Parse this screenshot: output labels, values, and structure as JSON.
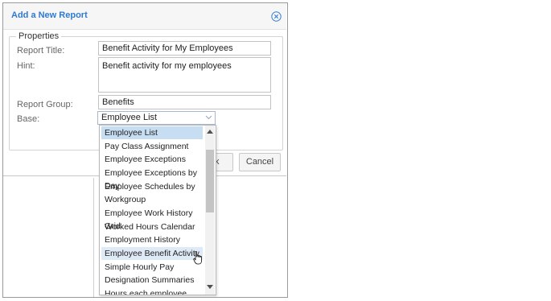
{
  "dialog": {
    "title": "Add a New Report",
    "close_icon": "close-circle-icon",
    "properties_legend": "Properties",
    "report_title": {
      "label": "Report Title:",
      "value": "Benefit Activity for My Employees"
    },
    "hint": {
      "label": "Hint:",
      "value": "Benefit activity for my employees"
    },
    "report_group": {
      "label": "Report Group:",
      "value": "Benefits"
    },
    "base": {
      "label": "Base:",
      "value": "Employee List"
    },
    "buttons": {
      "back_partial": "k",
      "cancel": "Cancel"
    }
  },
  "dropdown": {
    "items": [
      "Employee List",
      "Pay Class Assignment",
      "Employee Exceptions",
      "Employee Exceptions by Day",
      "Employee Schedules by",
      "Workgroup",
      "Employee Work History Grid",
      "Worked Hours Calendar",
      "Employment History Detail",
      "Employee Benefit Activity",
      "Simple Hourly Pay",
      "Designation Summaries",
      "Hours each employee"
    ],
    "selected_index": 0,
    "hover_index": 9
  },
  "colors": {
    "accent": "#2e7ad1",
    "selected": "#c7def2",
    "hover": "#dfeaf7"
  }
}
